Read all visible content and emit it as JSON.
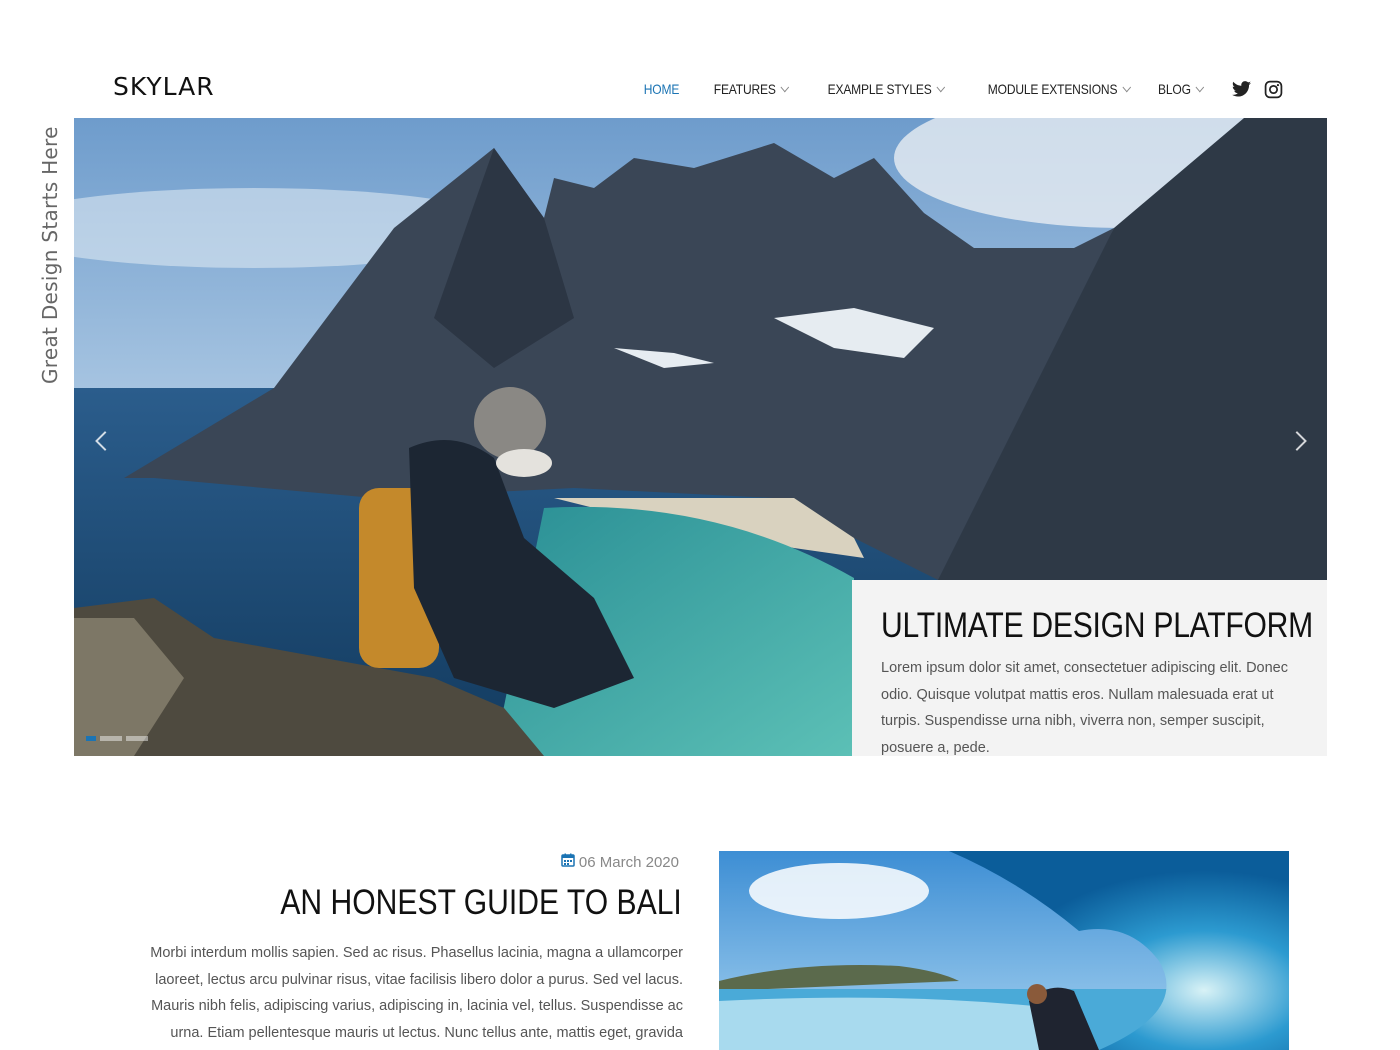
{
  "brand": {
    "logo": "SKYLAR"
  },
  "nav": {
    "items": [
      {
        "label": "HOME",
        "active": true,
        "dropdown": false
      },
      {
        "label": "FEATURES",
        "active": false,
        "dropdown": true
      },
      {
        "label": "EXAMPLE STYLES",
        "active": false,
        "dropdown": true
      },
      {
        "label": "MODULE EXTENSIONS",
        "active": false,
        "dropdown": true
      },
      {
        "label": "BLOG",
        "active": false,
        "dropdown": true
      }
    ],
    "social": [
      "twitter-icon",
      "instagram-icon"
    ]
  },
  "tagline": "Great Design Starts Here",
  "hero": {
    "title": "ULTIMATE DESIGN PLATFORM",
    "text": "Lorem ipsum dolor sit amet, consectetuer adipiscing elit. Donec odio. Quisque volutpat mattis eros. Nullam malesuada erat ut turpis. Suspendisse urna nibh, viverra non, semper suscipit, posuere a, pede.",
    "slides_total": 3,
    "slide_active": 1
  },
  "post": {
    "date": "06 March 2020",
    "title": "AN HONEST GUIDE TO BALI",
    "excerpt": "Morbi interdum mollis sapien. Sed ac risus. Phasellus lacinia, magna a ullamcorper laoreet, lectus arcu pulvinar risus, vitae facilisis libero dolor a purus. Sed vel lacus. Mauris nibh felis, adipiscing varius, adipiscing in, lacinia vel, tellus. Suspendisse ac urna. Etiam pellentesque mauris ut lectus. Nunc tellus ante, mattis eget, gravida"
  },
  "colors": {
    "accent": "#1b74b4",
    "panel": "#f3f3f3",
    "text": "#111111"
  }
}
